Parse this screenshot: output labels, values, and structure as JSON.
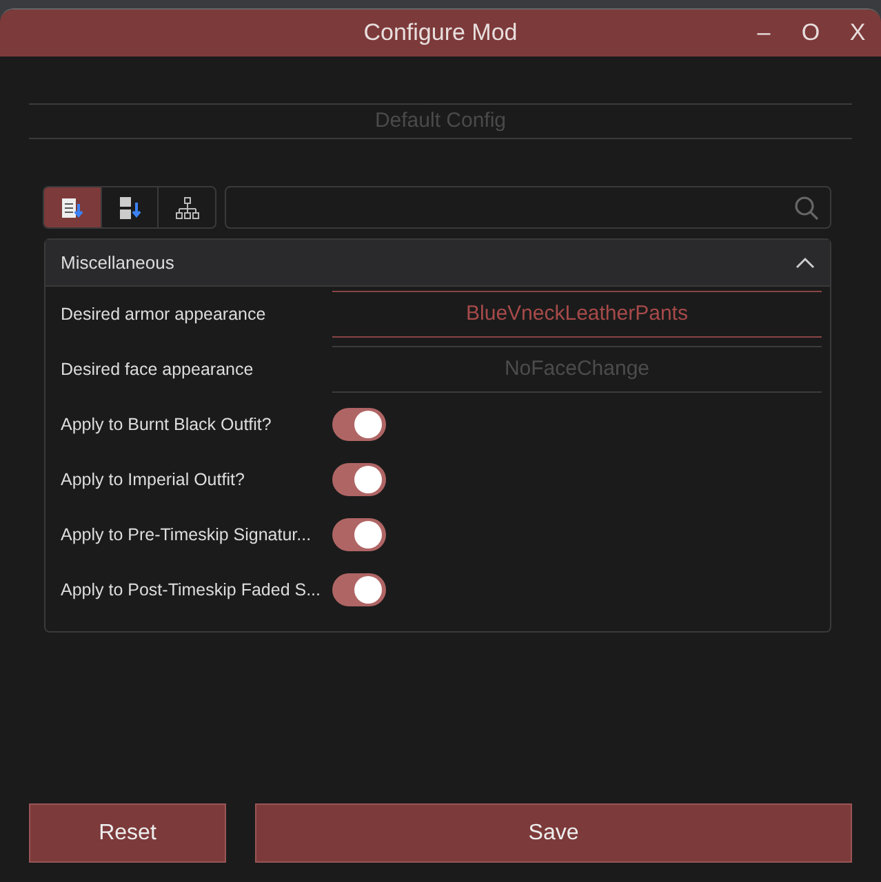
{
  "window": {
    "title": "Configure Mod",
    "controls": [
      "–",
      "O",
      "X"
    ]
  },
  "config_name": "Default Config",
  "toolbar": {
    "buttons": [
      {
        "kind": "category",
        "selected": true
      },
      {
        "kind": "alpha",
        "selected": false
      },
      {
        "kind": "tree",
        "selected": false
      }
    ]
  },
  "section": {
    "title": "Miscellaneous",
    "expanded": true,
    "settings": [
      {
        "kind": "text",
        "label": "Desired armor appearance",
        "value": "BlueVneckLeatherPants",
        "focused": true
      },
      {
        "kind": "text",
        "label": "Desired face appearance",
        "value": "NoFaceChange",
        "focused": false
      },
      {
        "kind": "toggle",
        "label": "Apply to Burnt Black Outfit?",
        "on": true
      },
      {
        "kind": "toggle",
        "label": "Apply to Imperial Outfit?",
        "on": true
      },
      {
        "kind": "toggle",
        "label": "Apply to Pre-Timeskip Signatur...",
        "on": true
      },
      {
        "kind": "toggle",
        "label": "Apply to Post-Timeskip Faded S...",
        "on": true
      }
    ]
  },
  "buttons": [
    "Reset",
    "Save"
  ]
}
